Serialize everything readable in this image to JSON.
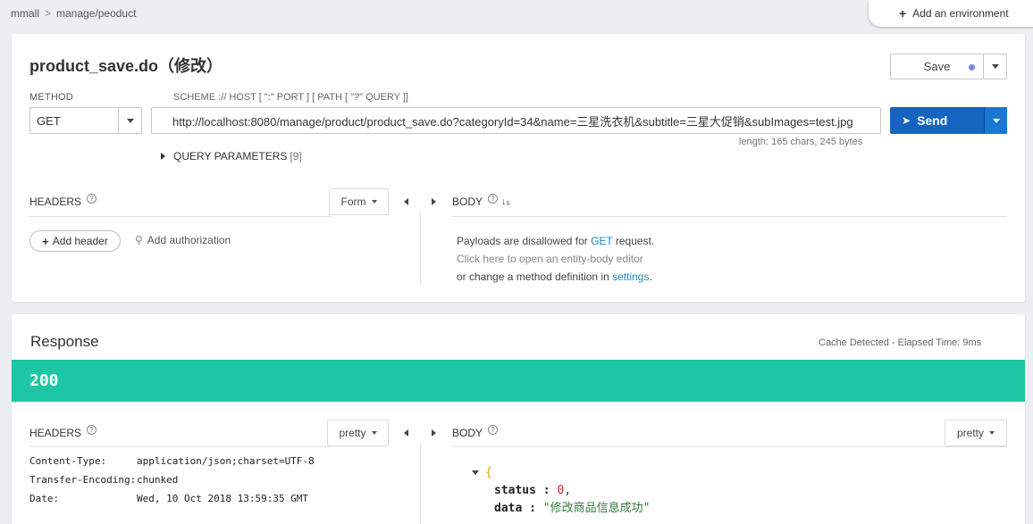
{
  "breadcrumb": {
    "root": "mmall",
    "separator": ">",
    "current": "manage/peoduct"
  },
  "environment": {
    "label": "Add an environment"
  },
  "request": {
    "title": "product_save.do（修改）",
    "save_label": "Save",
    "method_label": "METHOD",
    "method_value": "GET",
    "scheme_label": "SCHEME :// HOST [ \":\" PORT ] [ PATH [ \"?\" QUERY ]]",
    "url": "http://localhost:8080/manage/product/product_save.do?categoryId=34&name=三星洗衣机&subtitle=三星大促销&subImages=test.jpg",
    "url_length": "length: 165 chars, 245 bytes",
    "send_label": "Send",
    "query_params_label": "QUERY PARAMETERS",
    "query_params_count": "[9]",
    "headers_label": "HEADERS",
    "headers_mode": "Form",
    "body_label": "BODY",
    "add_header_label": "Add header",
    "add_auth_label": "Add authorization",
    "payload": {
      "line1_prefix": "Payloads are disallowed for ",
      "line1_method": "GET",
      "line1_suffix": " request.",
      "line2": "Click here to open an entity-body editor",
      "line3_prefix": "or change a method definition in ",
      "line3_link": "settings",
      "line3_suffix": "."
    }
  },
  "response": {
    "title": "Response",
    "cache_info": "Cache Detected - Elapsed Time: 9ms",
    "status_code": "200",
    "headers_label": "HEADERS",
    "headers_mode": "pretty",
    "body_label": "BODY",
    "body_mode": "pretty",
    "headers": [
      {
        "key": "Content-Type:",
        "value": "application/json;charset=UTF-8"
      },
      {
        "key": "Transfer-Encoding:",
        "value": "chunked"
      },
      {
        "key": "Date:",
        "value": "Wed, 10 Oct 2018 13:59:35 GMT"
      }
    ],
    "body": {
      "open_brace": "{",
      "status_key": "status",
      "status_value": "0",
      "data_key": "data",
      "data_value": "\"修改商品信息成功\""
    }
  },
  "colors": {
    "send": "#1565c0",
    "status_bar": "#1dc7a5",
    "link": "#1e88c8"
  },
  "icons": {
    "send": "paper-plane-icon",
    "help": "help-circle-icon",
    "sort": "sort-alpha-icon",
    "key": "key-icon"
  }
}
